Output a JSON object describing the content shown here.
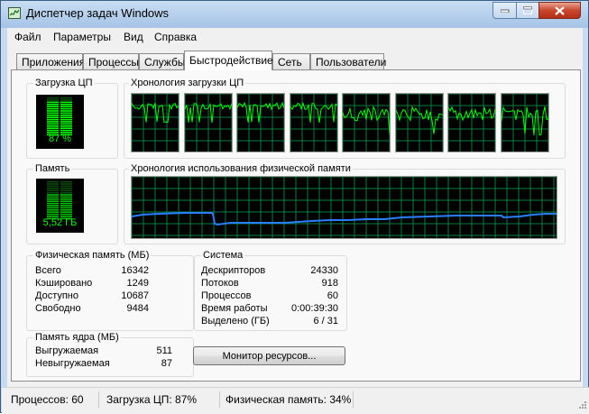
{
  "window": {
    "title": "Диспетчер задач Windows"
  },
  "menu": [
    "Файл",
    "Параметры",
    "Вид",
    "Справка"
  ],
  "tabs": [
    "Приложения",
    "Процессы",
    "Службы",
    "Быстродействие",
    "Сеть",
    "Пользователи"
  ],
  "active_tab": "Быстродействие",
  "cpu": {
    "label": "Загрузка ЦП",
    "value_text": "87 %",
    "load_fraction": 0.87
  },
  "cpu_history": {
    "label": "Хронология загрузки ЦП",
    "cores": 8
  },
  "memory": {
    "label": "Память",
    "value_text": "5,52 ГБ",
    "used_fraction": 0.34
  },
  "memory_history": {
    "label": "Хронология использования физической памяти"
  },
  "physical_memory": {
    "label": "Физическая память (МБ)",
    "rows": [
      {
        "key": "Всего",
        "value": "16342"
      },
      {
        "key": "Кэшировано",
        "value": "1249"
      },
      {
        "key": "Доступно",
        "value": "10687"
      },
      {
        "key": "Свободно",
        "value": "9484"
      }
    ]
  },
  "kernel_memory": {
    "label": "Память ядра (МБ)",
    "rows": [
      {
        "key": "Выгружаемая",
        "value": "511"
      },
      {
        "key": "Невыгружаемая",
        "value": "87"
      }
    ]
  },
  "system": {
    "label": "Система",
    "rows": [
      {
        "key": "Дескрипторов",
        "value": "24330"
      },
      {
        "key": "Потоков",
        "value": "918"
      },
      {
        "key": "Процессов",
        "value": "60"
      },
      {
        "key": "Время работы",
        "value": "0:00:39:30"
      },
      {
        "key": "Выделено (ГБ)",
        "value": "6 / 31"
      }
    ]
  },
  "resource_monitor_button": "Монитор ресурсов...",
  "status": {
    "processes": "Процессов: 60",
    "cpu": "Загрузка ЦП: 87%",
    "memory": "Физическая память: 34%"
  },
  "colors": {
    "meter_green": "#00ff00",
    "grid_green": "#008040",
    "memory_line": "#2a7fff"
  }
}
